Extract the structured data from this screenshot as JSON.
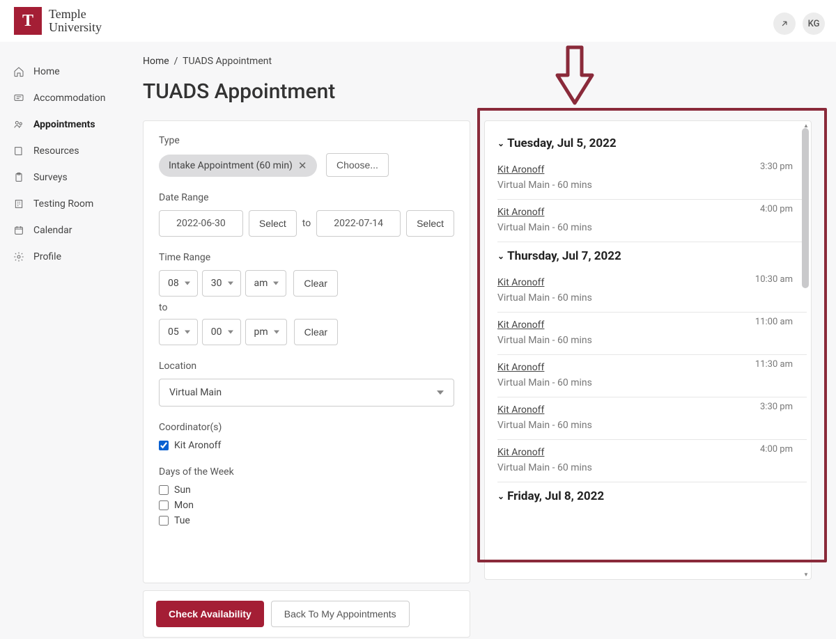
{
  "header": {
    "brand_line1": "Temple",
    "brand_line2": "University",
    "logo_letter": "T",
    "avatar_initials": "KG"
  },
  "sidebar": {
    "items": [
      {
        "label": "Home"
      },
      {
        "label": "Accommodation"
      },
      {
        "label": "Appointments"
      },
      {
        "label": "Resources"
      },
      {
        "label": "Surveys"
      },
      {
        "label": "Testing Room"
      },
      {
        "label": "Calendar"
      },
      {
        "label": "Profile"
      }
    ]
  },
  "breadcrumb": {
    "home": "Home",
    "sep": "/",
    "current": "TUADS Appointment"
  },
  "page_title": "TUADS Appointment",
  "form": {
    "type_label": "Type",
    "type_chip": "Intake Appointment (60 min)",
    "choose_label": "Choose...",
    "date_range_label": "Date Range",
    "date_from": "2022-06-30",
    "date_to": "2022-07-14",
    "select_label": "Select",
    "to_label": "to",
    "time_range_label": "Time Range",
    "time_from_h": "08",
    "time_from_m": "30",
    "time_from_ap": "am",
    "time_to_h": "05",
    "time_to_m": "00",
    "time_to_ap": "pm",
    "clear_label": "Clear",
    "location_label": "Location",
    "location_value": "Virtual Main",
    "coordinators_label": "Coordinator(s)",
    "coordinator_name": "Kit Aronoff",
    "days_label": "Days of the Week",
    "days": [
      "Sun",
      "Mon",
      "Tue"
    ]
  },
  "actions": {
    "check": "Check Availability",
    "back": "Back To My Appointments"
  },
  "results": {
    "days": [
      {
        "title": "Tuesday, Jul 5, 2022",
        "slots": [
          {
            "name": "Kit Aronoff",
            "loc": "Virtual Main - 60 mins",
            "time": "3:30 pm"
          },
          {
            "name": "Kit Aronoff",
            "loc": "Virtual Main - 60 mins",
            "time": "4:00 pm"
          }
        ]
      },
      {
        "title": "Thursday, Jul 7, 2022",
        "slots": [
          {
            "name": "Kit Aronoff",
            "loc": "Virtual Main - 60 mins",
            "time": "10:30 am"
          },
          {
            "name": "Kit Aronoff",
            "loc": "Virtual Main - 60 mins",
            "time": "11:00 am"
          },
          {
            "name": "Kit Aronoff",
            "loc": "Virtual Main - 60 mins",
            "time": "11:30 am"
          },
          {
            "name": "Kit Aronoff",
            "loc": "Virtual Main - 60 mins",
            "time": "3:30 pm"
          },
          {
            "name": "Kit Aronoff",
            "loc": "Virtual Main - 60 mins",
            "time": "4:00 pm"
          }
        ]
      },
      {
        "title": "Friday, Jul 8, 2022",
        "slots": []
      }
    ]
  }
}
